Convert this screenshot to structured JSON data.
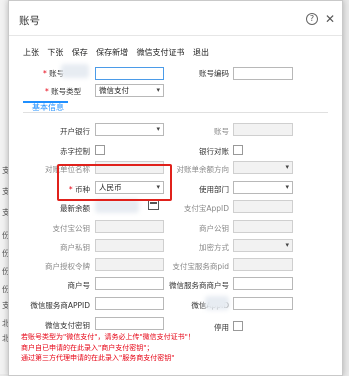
{
  "dialog": {
    "title": "账号",
    "help_icon": "question-circle-icon",
    "close_icon": "close-icon"
  },
  "toolbar": [
    "上张",
    "下张",
    "保存",
    "保存新增",
    "微信支付证书",
    "退出"
  ],
  "section_title": "基本信息",
  "top": {
    "account_label": "账号",
    "account_type_label": "账号类型",
    "account_type_value": "微信支付",
    "account_code_label": "账号编码"
  },
  "form": {
    "bank_label": "开户银行",
    "acct_label": "账号",
    "redzero_label": "赤字控制",
    "bankdir_label": "银行对账",
    "opp_unit_label": "对账单位名称",
    "bill_dir_label": "对账单余额方向",
    "currency_label": "币种",
    "currency_value": "人民币",
    "dept_label": "使用部门",
    "latest_label": "最新余额",
    "appid_label": "支付宝AppID",
    "alipay_acct_label": "支付宝公钥",
    "merchant_pub_label": "商户公钥",
    "merchant_priv_label": "商户私钥",
    "encrypt_label": "加密方式",
    "auth_token_label": "商户授权令牌",
    "provider_pid_label": "支付宝服务商pid",
    "merchant_no_label": "商户号",
    "wx_provider_no_label": "微信服务商商户号",
    "wx_provider_appid_label": "微信服务商APPID",
    "wx_appid_label": "微信AppID",
    "wx_key_label": "微信支付密钥",
    "disabled_label": "停用"
  },
  "notes": [
    "若账号类型为\"微信支付\"，请务必上传\"微信支付证书\"！",
    "商户自已申请的在此录入\"商户支付密钥\"；",
    "通过第三方代理申请的在此录入\"服务商支付密钥\""
  ],
  "side_labels": [
    "支",
    "支",
    "支",
    "份",
    "份",
    "份",
    "份",
    "支",
    "北",
    "北"
  ],
  "colors": {
    "accent": "#1e8fff",
    "required": "#e60012",
    "highlight": "#e0211b"
  }
}
